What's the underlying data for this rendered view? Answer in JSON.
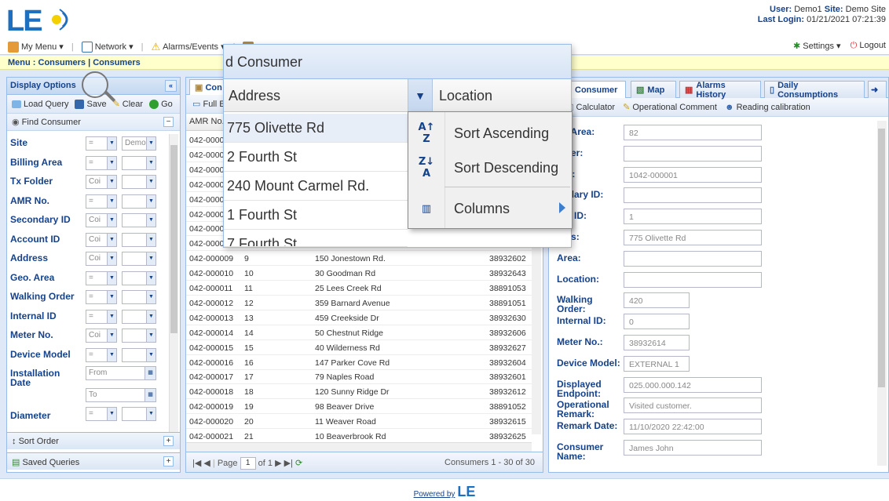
{
  "header": {
    "logo_text": "LE",
    "user_label": "User:",
    "user_value": "Demo1",
    "site_label": "Site:",
    "site_value": "Demo Site",
    "login_label": "Last Login:",
    "login_value": "01/21/2021 07:21:39"
  },
  "menubar": {
    "items": [
      "My Menu ▾",
      "Network ▾",
      "Alarms/Events ▾"
    ],
    "settings": "Settings ▾",
    "logout": "Logout"
  },
  "breadcrumb": "Menu : Consumers | Consumers",
  "left": {
    "title": "Display Options",
    "toolbar": [
      "Load Query",
      "Save",
      "Clear",
      "Go"
    ],
    "find": "Find Consumer",
    "filters": [
      {
        "label": "Site",
        "op": "=",
        "val": "Demo"
      },
      {
        "label": "Billing Area",
        "op": "=",
        "val": ""
      },
      {
        "label": "Tx Folder",
        "op": "Coi",
        "val": ""
      },
      {
        "label": "AMR No.",
        "op": "=",
        "val": ""
      },
      {
        "label": "Secondary ID",
        "op": "Coi",
        "val": ""
      },
      {
        "label": "Account ID",
        "op": "Coi",
        "val": ""
      },
      {
        "label": "Address",
        "op": "Coi",
        "val": ""
      },
      {
        "label": "Geo. Area",
        "op": "=",
        "val": ""
      },
      {
        "label": "Walking Order",
        "op": "=",
        "val": ""
      },
      {
        "label": "Internal ID",
        "op": "=",
        "val": ""
      },
      {
        "label": "Meter No.",
        "op": "Coi",
        "val": ""
      },
      {
        "label": "Device Model",
        "op": "=",
        "val": ""
      }
    ],
    "install_label": "Installation Date",
    "from": "From",
    "to": "To",
    "diameter": "Diameter",
    "sort_order": "Sort Order",
    "saved_queries": "Saved Queries"
  },
  "center": {
    "tab": "Con",
    "toolbar": "Full E",
    "col_amr": "AMR No.",
    "rows": [
      {
        "amr": "042-00000",
        "id": "",
        "addr": "",
        "meter": ""
      },
      {
        "amr": "042-00000",
        "id": "",
        "addr": "",
        "meter": ""
      },
      {
        "amr": "042-00000",
        "id": "",
        "addr": "",
        "meter": ""
      },
      {
        "amr": "042-00000",
        "id": "",
        "addr": "",
        "meter": ""
      },
      {
        "amr": "042-00000",
        "id": "",
        "addr": "",
        "meter": ""
      },
      {
        "amr": "042-00000",
        "id": "",
        "addr": "",
        "meter": ""
      },
      {
        "amr": "042-00000",
        "id": "",
        "addr": "",
        "meter": ""
      },
      {
        "amr": "042-00000",
        "id": "",
        "addr": "",
        "meter": ""
      },
      {
        "amr": "042-000009",
        "id": "9",
        "addr": "150 Jonestown Rd.",
        "meter": "38932602"
      },
      {
        "amr": "042-000010",
        "id": "10",
        "addr": "30 Goodman Rd",
        "meter": "38932643"
      },
      {
        "amr": "042-000011",
        "id": "11",
        "addr": "25 Lees Creek Rd",
        "meter": "38891053"
      },
      {
        "amr": "042-000012",
        "id": "12",
        "addr": "359 Barnard Avenue",
        "meter": "38891051"
      },
      {
        "amr": "042-000013",
        "id": "13",
        "addr": "459 Creekside Dr",
        "meter": "38932630"
      },
      {
        "amr": "042-000014",
        "id": "14",
        "addr": "50 Chestnut Ridge",
        "meter": "38932606"
      },
      {
        "amr": "042-000015",
        "id": "15",
        "addr": "40 Wilderness Rd",
        "meter": "38932627"
      },
      {
        "amr": "042-000016",
        "id": "16",
        "addr": "147 Parker Cove Rd",
        "meter": "38932604"
      },
      {
        "amr": "042-000017",
        "id": "17",
        "addr": "79 Naples Road",
        "meter": "38932601"
      },
      {
        "amr": "042-000018",
        "id": "18",
        "addr": "120 Sunny Ridge Dr",
        "meter": "38932612"
      },
      {
        "amr": "042-000019",
        "id": "19",
        "addr": "98 Beaver Drive",
        "meter": "38891052"
      },
      {
        "amr": "042-000020",
        "id": "20",
        "addr": "11 Weaver Road",
        "meter": "38932615"
      },
      {
        "amr": "042-000021",
        "id": "21",
        "addr": "10 Beaverbrook Rd",
        "meter": "38932625"
      }
    ],
    "page_label": "Page",
    "page_value": "1",
    "of_label": "of 1",
    "summary": "Consumers 1 - 30 of 30"
  },
  "right": {
    "tabs": [
      "Consumer",
      "Map",
      "Alarms History",
      "Daily Consumptions"
    ],
    "toolbar": [
      "t",
      "Calculator",
      "Operational Comment",
      "Reading calibration"
    ],
    "fields": [
      {
        "label": "ng Area:",
        "value": "82"
      },
      {
        "label": "older:",
        "value": ""
      },
      {
        "label": "No.:",
        "value": "1042-000001"
      },
      {
        "label": "ondary ID:",
        "value": ""
      },
      {
        "label": "unt ID:",
        "value": "1"
      },
      {
        "label": "ress:",
        "value": "775 Olivette Rd"
      },
      {
        "label": "Area:",
        "value": ""
      },
      {
        "label": "Location:",
        "value": ""
      },
      {
        "label": "Walking Order:",
        "value": "420"
      },
      {
        "label": "Internal ID:",
        "value": "0"
      },
      {
        "label": "Meter No.:",
        "value": "38932614"
      },
      {
        "label": "Device Model:",
        "value": "EXTERNAL 1"
      },
      {
        "label": "Displayed Endpoint:",
        "value": "025.000.000.142"
      },
      {
        "label": "Operational Remark:",
        "value": "Visited customer."
      },
      {
        "label": "Remark Date:",
        "value": "11/10/2020 22:42:00"
      },
      {
        "label": "Consumer Name:",
        "value": "James John"
      }
    ]
  },
  "popup": {
    "title": "d Consumer",
    "col_address": "Address",
    "col_location": "Location",
    "rows": [
      "775 Olivette Rd",
      "2 Fourth St",
      "240 Mount Carmel Rd.",
      "1 Fourth St",
      "7 Fourth St"
    ]
  },
  "context_menu": {
    "sort_asc": "Sort Ascending",
    "sort_desc": "Sort Descending",
    "columns": "Columns"
  },
  "footer": {
    "powered": "Powered by",
    "brand": "LE"
  }
}
